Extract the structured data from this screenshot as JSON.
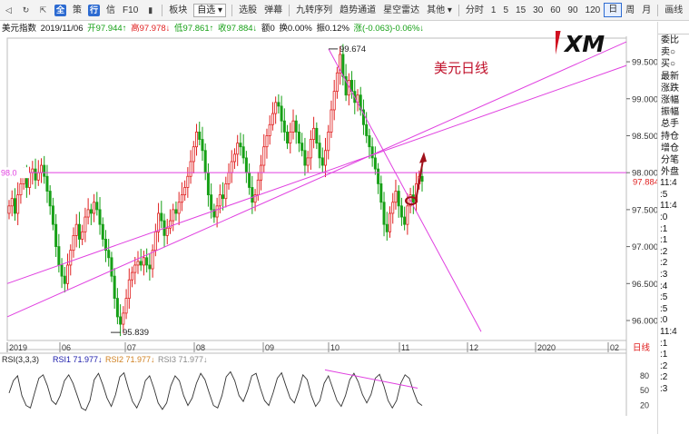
{
  "toolbar": {
    "icons": [
      "back-icon",
      "refresh-icon",
      "fullscreen-icon",
      "cursor-icon"
    ],
    "boxed_icon_1": "全",
    "item_ce": "策",
    "boxed_icon_2": "行",
    "item_xin": "信",
    "item_f10": "F10",
    "item_bankuai": "板块",
    "select_value": "自选",
    "items_mid": [
      "选股",
      "弹幕"
    ],
    "items_tools": [
      "九转序列",
      "趋势通道",
      "星空雷达",
      "其他"
    ],
    "periods": [
      "分时",
      "1",
      "5",
      "15",
      "30",
      "60",
      "90",
      "120",
      "日",
      "周",
      "月"
    ],
    "active_period": "日",
    "draw_label": "画线"
  },
  "infobar": {
    "name": "美元指数",
    "date": "2019/11/06",
    "open": "开97.944↑",
    "high": "高97.978↓",
    "low": "低97.861↑",
    "close": "收97.884↓",
    "amount": "额0",
    "turnover": "换0.00%",
    "amplitude": "振0.12%",
    "change": "涨(-0.063)-0.06%↓"
  },
  "chart_title": "美元日线",
  "logo_text": "XM",
  "chart_data": {
    "type": "line",
    "x_tick_labels": [
      "2019",
      "06",
      "07",
      "08",
      "09",
      "10",
      "11",
      "12",
      "2020",
      "02"
    ],
    "y_tick_labels": [
      "99.500",
      "99.000",
      "98.500",
      "98.000",
      "97.500",
      "97.000",
      "96.500",
      "96.000"
    ],
    "ylim": [
      95.73,
      99.82
    ],
    "high_label": "99.674",
    "low_label": "95.839",
    "left_level_label": "98.0",
    "current_price": "97.884",
    "current_price_value": 97.884,
    "horizontal_level": 98.0,
    "period_label": "日线",
    "close_series": [
      97.55,
      97.65,
      97.45,
      97.7,
      97.85,
      97.95,
      97.8,
      98.0,
      98.05,
      97.9,
      98.0,
      98.1,
      97.95,
      97.75,
      97.55,
      97.3,
      97.0,
      96.75,
      96.6,
      96.5,
      96.75,
      96.95,
      97.15,
      97.3,
      97.1,
      97.2,
      97.4,
      97.5,
      97.45,
      97.6,
      97.5,
      97.3,
      97.1,
      96.95,
      96.85,
      96.6,
      96.3,
      96.05,
      95.95,
      96.1,
      96.3,
      96.55,
      96.65,
      96.75,
      96.8,
      96.75,
      96.85,
      96.75,
      96.7,
      96.95,
      97.2,
      97.45,
      97.35,
      97.15,
      97.25,
      97.35,
      97.5,
      97.45,
      97.6,
      97.7,
      97.8,
      97.95,
      98.15,
      98.35,
      98.55,
      98.45,
      98.3,
      98.0,
      97.7,
      97.5,
      97.4,
      97.55,
      97.7,
      97.65,
      97.85,
      98.0,
      98.15,
      98.25,
      98.4,
      98.35,
      98.2,
      98.0,
      97.8,
      97.6,
      97.7,
      97.9,
      98.1,
      98.35,
      98.5,
      98.65,
      98.8,
      98.95,
      98.9,
      98.7,
      98.55,
      98.4,
      98.55,
      98.7,
      98.55,
      98.4,
      98.3,
      98.1,
      98.2,
      98.45,
      98.6,
      98.4,
      98.2,
      98.1,
      98.3,
      98.55,
      98.85,
      99.1,
      99.35,
      99.6,
      99.3,
      99.05,
      99.25,
      99.1,
      98.95,
      99.05,
      98.85,
      98.65,
      98.5,
      98.35,
      98.2,
      98.05,
      97.85,
      97.6,
      97.3,
      97.2,
      97.45,
      97.6,
      97.75,
      97.55,
      97.4,
      97.3,
      97.55,
      97.7,
      97.6,
      97.85,
      97.95,
      97.884
    ]
  },
  "rsi": {
    "label": "RSI(3,3,3)",
    "rsi1": "RSI1 71.977↓",
    "rsi2": "RSI2 71.977↓",
    "rsi3": "RSI3 71.977↓",
    "y_tick_labels": [
      "80",
      "50",
      "20"
    ],
    "ylim": [
      10,
      100
    ],
    "series": [
      45,
      70,
      80,
      40,
      20,
      15,
      45,
      75,
      82,
      60,
      30,
      22,
      40,
      70,
      82,
      65,
      40,
      15,
      10,
      30,
      72,
      85,
      62,
      35,
      18,
      42,
      78,
      86,
      55,
      28,
      15,
      35,
      70,
      80,
      55,
      25,
      12,
      25,
      60,
      80,
      70,
      40,
      20,
      35,
      65,
      85,
      72,
      45,
      20,
      15,
      40,
      78,
      88,
      70,
      40,
      28,
      50,
      80,
      85,
      55,
      30,
      20,
      45,
      75,
      86,
      60,
      35,
      25,
      50,
      82,
      72,
      40,
      18,
      30,
      65,
      80,
      55,
      30,
      18,
      40,
      72,
      85,
      68,
      42,
      25,
      42,
      75,
      83,
      60,
      30,
      15,
      30,
      65,
      82,
      75,
      48,
      26,
      20
    ]
  },
  "right_panel": {
    "rows": [
      "委比",
      "卖○",
      "买○",
      "最新",
      "涨跌",
      "涨幅",
      "振幅",
      "总手",
      "持仓",
      "增仓",
      "分笔",
      "外盘"
    ],
    "times": [
      "11:4",
      ":5",
      "11:4",
      ":0",
      ":1",
      ":1",
      ":2",
      ":2",
      ":3",
      ":4",
      ":5",
      ":5",
      ":0",
      "11:4",
      ":1",
      ":1",
      ":2",
      ":2",
      ":3"
    ]
  },
  "colors": {
    "up": "#e02020",
    "down": "#16a016",
    "trendline": "#e040e0",
    "arrow": "#a0101a",
    "accent": "#2d6bd1"
  }
}
